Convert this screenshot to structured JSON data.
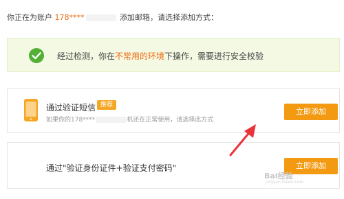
{
  "intro": {
    "prefix": "你正在为账户",
    "account": "178****",
    "suffix": "添加邮箱，请选择添加方式："
  },
  "notice": {
    "icon": "check-circle-icon",
    "before": "经过检测，你在",
    "highlight": "不常用的环境",
    "after": "下操作，需要进行安全校验"
  },
  "options": [
    {
      "icon": "phone-icon",
      "title": "通过验证短信",
      "badge": "推荐",
      "sub_prefix": "如果你的178****",
      "sub_suffix": "机还在正常使用，请选择此方式",
      "button": "立即添加"
    },
    {
      "title": "通过\"验证身份证件+验证支付密码\"",
      "button": "立即添加"
    }
  ],
  "watermark": {
    "text": "Bai经验",
    "sub": "jingyan.baidu.com"
  },
  "colors": {
    "accent": "#f39a12",
    "highlight": "#f06a0f",
    "notice_bg": "#f3f9e3",
    "check": "#52b034",
    "arrow": "#e8343a"
  }
}
